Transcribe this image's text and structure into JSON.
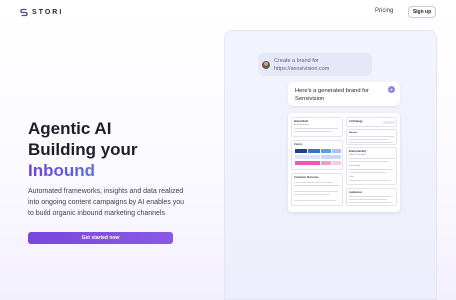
{
  "header": {
    "logo_text": "STORI",
    "nav_pricing": "Pricing",
    "signup_label": "Sign up"
  },
  "hero": {
    "title_line1": "Agentic AI",
    "title_line2": "Building your",
    "title_highlight": "Inbound",
    "desc_line1": "Automated frameworks, insights and data realized",
    "desc_line2": "into ongoing content campaigns by AI enables you",
    "desc_line3": "to build organic inbound marketing channels",
    "cta_label": "Get started now"
  },
  "chat": {
    "user_line1": "Create a brand for",
    "user_line2": "https://sensivision.com",
    "ai_line1": "Here's a generated brand for",
    "ai_line2": "Sensivision"
  },
  "brand_card": {
    "sections": {
      "brand_brief": "Brand Brief",
      "strategy": "AI Strategy",
      "colors": "Colors",
      "brand_identity": "Brand Identity",
      "customer_personas": "Customer Personas",
      "audiences": "Audiences"
    },
    "labels": {
      "brand_essence": "Brand Essence",
      "mission": "Mission",
      "value_proposition": "Value Proposition",
      "personality": "Personality",
      "tone": "Tone"
    }
  },
  "colors": {
    "accent": "#7b46dc",
    "gradient_start": "#6f3fd9",
    "gradient_end": "#4e8fe8",
    "palette": [
      "#1f3f8a",
      "#3e6fcf",
      "#6a9ae4",
      "#a9c4f0",
      "#d9e5fb",
      "#e85ab5",
      "#f39ad1",
      "#f8c9e7"
    ]
  }
}
